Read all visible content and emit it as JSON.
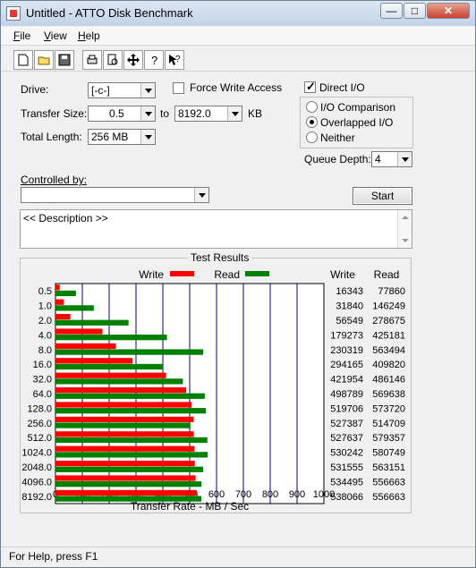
{
  "window": {
    "title": "Untitled - ATTO Disk Benchmark"
  },
  "menu": {
    "items": [
      {
        "hot": "F",
        "rest": "ile"
      },
      {
        "hot": "V",
        "rest": "iew"
      },
      {
        "hot": "H",
        "rest": "elp"
      }
    ]
  },
  "toolbar": {
    "icons": [
      "new-document-icon",
      "open-folder-icon",
      "save-disk-icon",
      "print-icon",
      "print-preview-icon",
      "move-arrows-icon",
      "help-question-icon",
      "context-help-icon"
    ]
  },
  "settings": {
    "drive_label": "Drive:",
    "drive_value": "[-c-]",
    "force_write_label": "Force Write Access",
    "direct_io_label": "Direct I/O",
    "transfer_size_label": "Transfer Size:",
    "transfer_from": "0.5",
    "to_label": "to",
    "transfer_to": "8192.0",
    "kb_label": "KB",
    "total_length_label": "Total Length:",
    "total_length_value": "256 MB",
    "io_comparison_label": "I/O Comparison",
    "overlapped_io_label": "Overlapped I/O",
    "neither_label": "Neither",
    "queue_depth_label": "Queue Depth:",
    "queue_depth_value": "4",
    "controlled_by_label": "Controlled by:",
    "controlled_by_value": "",
    "start_label": "Start",
    "description": "<< Description >>"
  },
  "chart_data": {
    "type": "bar",
    "title": "Test Results",
    "xlabel": "Transfer Rate - MB / Sec",
    "xlim": [
      0,
      1000
    ],
    "xticks": [
      "0",
      "100",
      "200",
      "300",
      "400",
      "500",
      "600",
      "700",
      "800",
      "900",
      "1000"
    ],
    "categories": [
      "0.5",
      "1.0",
      "2.0",
      "4.0",
      "8.0",
      "16.0",
      "32.0",
      "64.0",
      "128.0",
      "256.0",
      "512.0",
      "1024.0",
      "2048.0",
      "4096.0",
      "8192.0"
    ],
    "series": [
      {
        "name": "Write",
        "color": "#ff0000",
        "values": [
          16343,
          31840,
          56549,
          179273,
          230319,
          294165,
          421954,
          498789,
          519706,
          527387,
          527637,
          530242,
          531555,
          534495,
          538066
        ]
      },
      {
        "name": "Read",
        "color": "#008000",
        "values": [
          77860,
          146249,
          278675,
          425181,
          563494,
          409820,
          486146,
          569638,
          573720,
          514709,
          579357,
          580749,
          563151,
          556663,
          556663
        ]
      }
    ],
    "value_units": "KB/s",
    "column_headers": {
      "write": "Write",
      "read": "Read"
    },
    "legend": "top-center",
    "grid": true
  },
  "status": {
    "text": "For Help, press F1"
  }
}
